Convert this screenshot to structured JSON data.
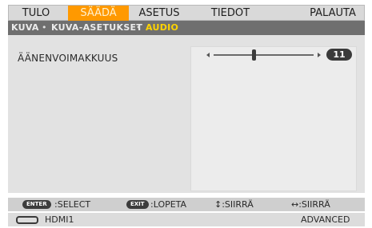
{
  "menu": {
    "tabs": [
      {
        "label": "TULO"
      },
      {
        "label": "SÄÄDÄ",
        "active": true
      },
      {
        "label": "ASETUS"
      },
      {
        "label": "TIEDOT"
      },
      {
        "label": "PALAUTA"
      }
    ]
  },
  "breadcrumb": {
    "items": [
      "KUVA",
      "KUVA-ASETUKSET",
      "AUDIO"
    ],
    "separator": "•"
  },
  "settings": {
    "volume": {
      "label": "ÄÄNENVOIMAKKUUS",
      "value": "11",
      "level": 0.4
    }
  },
  "hints": {
    "enter_key": "ENTER",
    "enter_text": ":SELECT",
    "exit_key": "EXIT",
    "exit_text": ":LOPETA",
    "updown_text": "↕:SIIRRÄ",
    "leftright_text": "↔:SIIRRÄ"
  },
  "status": {
    "source": "HDMI1",
    "mode": "ADVANCED"
  },
  "colors": {
    "accent": "#ff9900",
    "breadcrumb_active": "#ffd400",
    "crumb_bg": "#6f6f6f"
  }
}
